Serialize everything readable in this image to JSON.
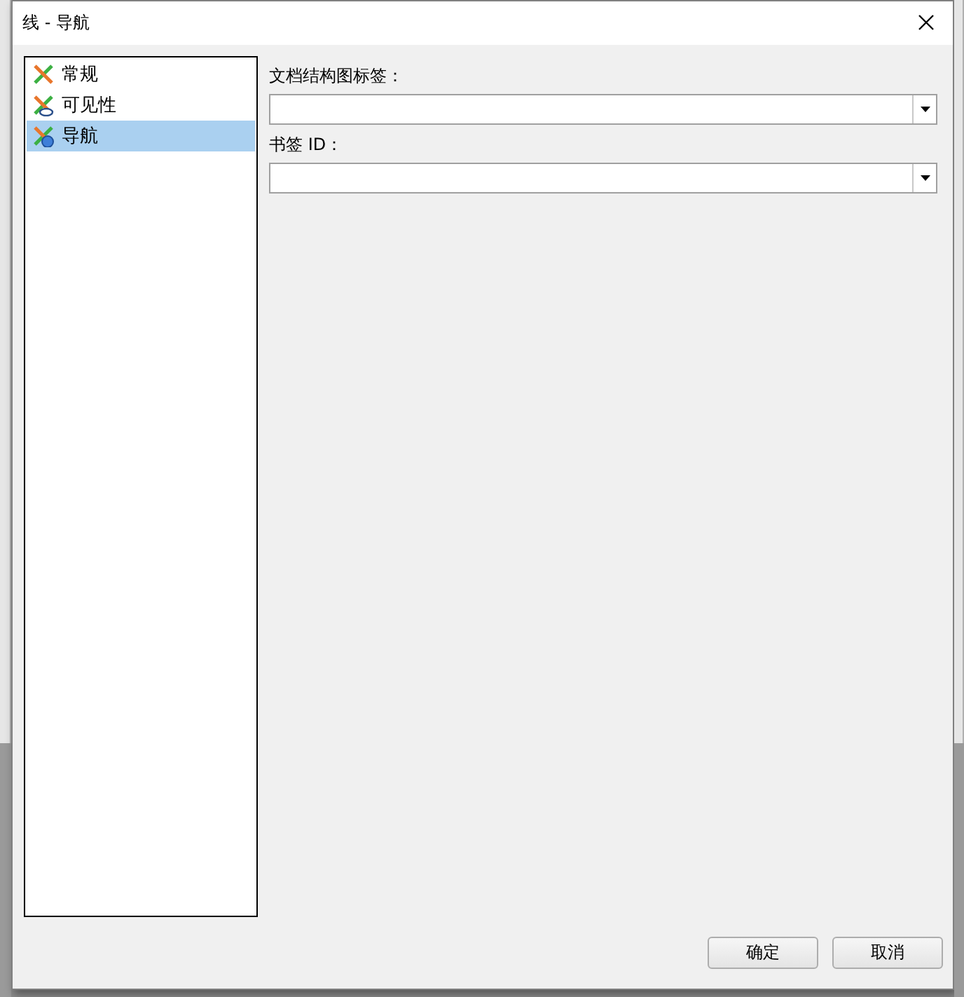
{
  "window": {
    "title": "线 - 导航"
  },
  "tree": {
    "items": [
      {
        "label": "常规",
        "kind": "general",
        "selected": false
      },
      {
        "label": "可见性",
        "kind": "visibility",
        "selected": false
      },
      {
        "label": "导航",
        "kind": "navigation",
        "selected": true
      }
    ]
  },
  "fields": [
    {
      "label": "文档结构图标签："
    },
    {
      "label": "书签 ID："
    }
  ],
  "buttons": [
    {
      "label": "确定"
    },
    {
      "label": "取消"
    }
  ]
}
